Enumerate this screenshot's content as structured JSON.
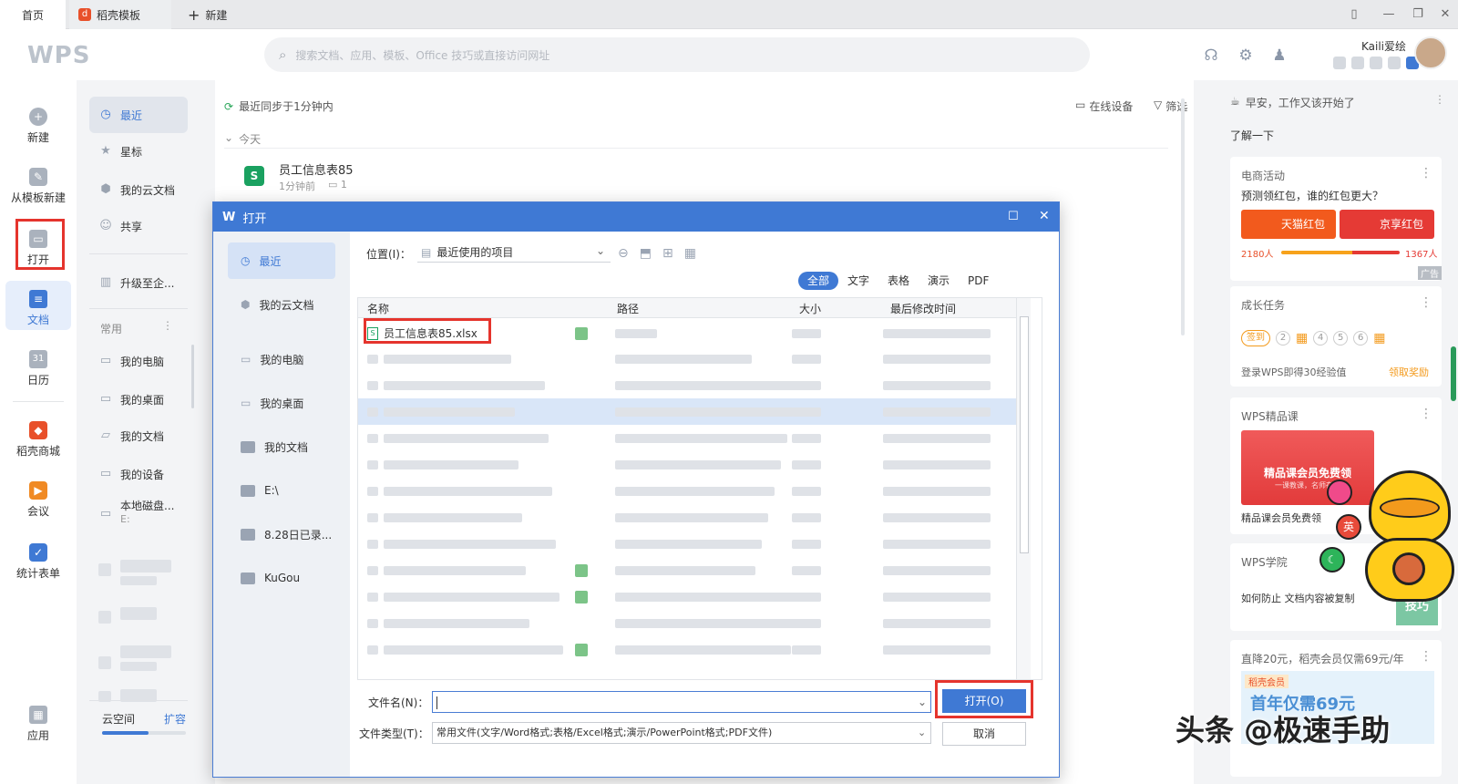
{
  "tabs": {
    "home": "首页",
    "template": "稻壳模板",
    "new": "新建"
  },
  "header": {
    "logo": "WPS",
    "search_placeholder": "搜索文档、应用、模板、Office 技巧或直接访问网址",
    "user_name": "Kaili爱绘"
  },
  "rail": {
    "new": "新建",
    "from_template": "从模板新建",
    "open": "打开",
    "docs": "文档",
    "calendar": "日历",
    "calendar_day": "31",
    "store": "稻壳商城",
    "meeting": "会议",
    "form": "统计表单",
    "apps": "应用"
  },
  "nav": {
    "recent": "最近",
    "starred": "星标",
    "cloud": "我的云文档",
    "shared": "共享",
    "upgrade": "升级至企...",
    "common": "常用",
    "my_pc": "我的电脑",
    "my_desktop": "我的桌面",
    "my_docs": "我的文档",
    "my_devices": "我的设备",
    "local_disk": "本地磁盘...",
    "local_disk_sub": "E:",
    "cloud_space": "云空间",
    "expand": "扩容",
    "cloud_usage_fraction": 0.55
  },
  "main": {
    "sync_status": "最近同步于1分钟内",
    "online_devices": "在线设备",
    "filter": "筛选",
    "group_today": "今天",
    "file_name": "员工信息表85",
    "file_time": "1分钟前",
    "file_comments": "1"
  },
  "right": {
    "greeting": "早安，工作又该开始了",
    "learn": "了解一下",
    "ecom": {
      "title": "电商活动",
      "question": "预测领红包，谁的红包更大？",
      "tmall": "天猫红包",
      "jd": "京享红包",
      "tmall_count": "2180人",
      "jd_count": "1367人",
      "ad": "广告"
    },
    "growth": {
      "title": "成长任务",
      "checkin": "签到",
      "steps": [
        "2",
        "4",
        "5",
        "6"
      ],
      "desc": "登录WPS即得30经验值",
      "reward": "领取奖励"
    },
    "course": {
      "title": "WPS精品课",
      "banner": "精品课会员免费领",
      "banner_sub": "一课教课，名师在线",
      "caption": "精品课会员免费领"
    },
    "academy": {
      "title": "WPS学院",
      "tip": "如何防止 文档内容被复制",
      "badge": "技巧"
    },
    "promo": {
      "title": "直降20元，稻壳会员仅需69元/年",
      "tag": "稻壳会员",
      "big": "首年仅需69元"
    }
  },
  "float": {
    "ying": "英"
  },
  "dialog": {
    "title": "打开",
    "location_label": "位置(I)：",
    "location_value": "最近使用的项目",
    "file_types": [
      "全部",
      "文字",
      "表格",
      "演示",
      "PDF"
    ],
    "columns": {
      "name": "名称",
      "path": "路径",
      "size": "大小",
      "modified": "最后修改时间"
    },
    "first_file": "员工信息表85.xlsx",
    "sidebar": [
      "最近",
      "我的云文档",
      "我的电脑",
      "我的桌面",
      "我的文档",
      "E:\\",
      "8.28日已录...",
      "KuGou"
    ],
    "filename_label": "文件名(N)：",
    "filename_value": "",
    "filetype_label": "文件类型(T)：",
    "filetype_value": "常用文件(文字/Word格式;表格/Excel格式;演示/PowerPoint格式;PDF文件)",
    "open_button": "打开(O)",
    "cancel_button": "取消"
  },
  "watermark": "头条 @极速手助",
  "colors": {
    "accent": "#3f79d4",
    "red_highlight": "#e5342d",
    "sheet_green": "#1aa160"
  }
}
